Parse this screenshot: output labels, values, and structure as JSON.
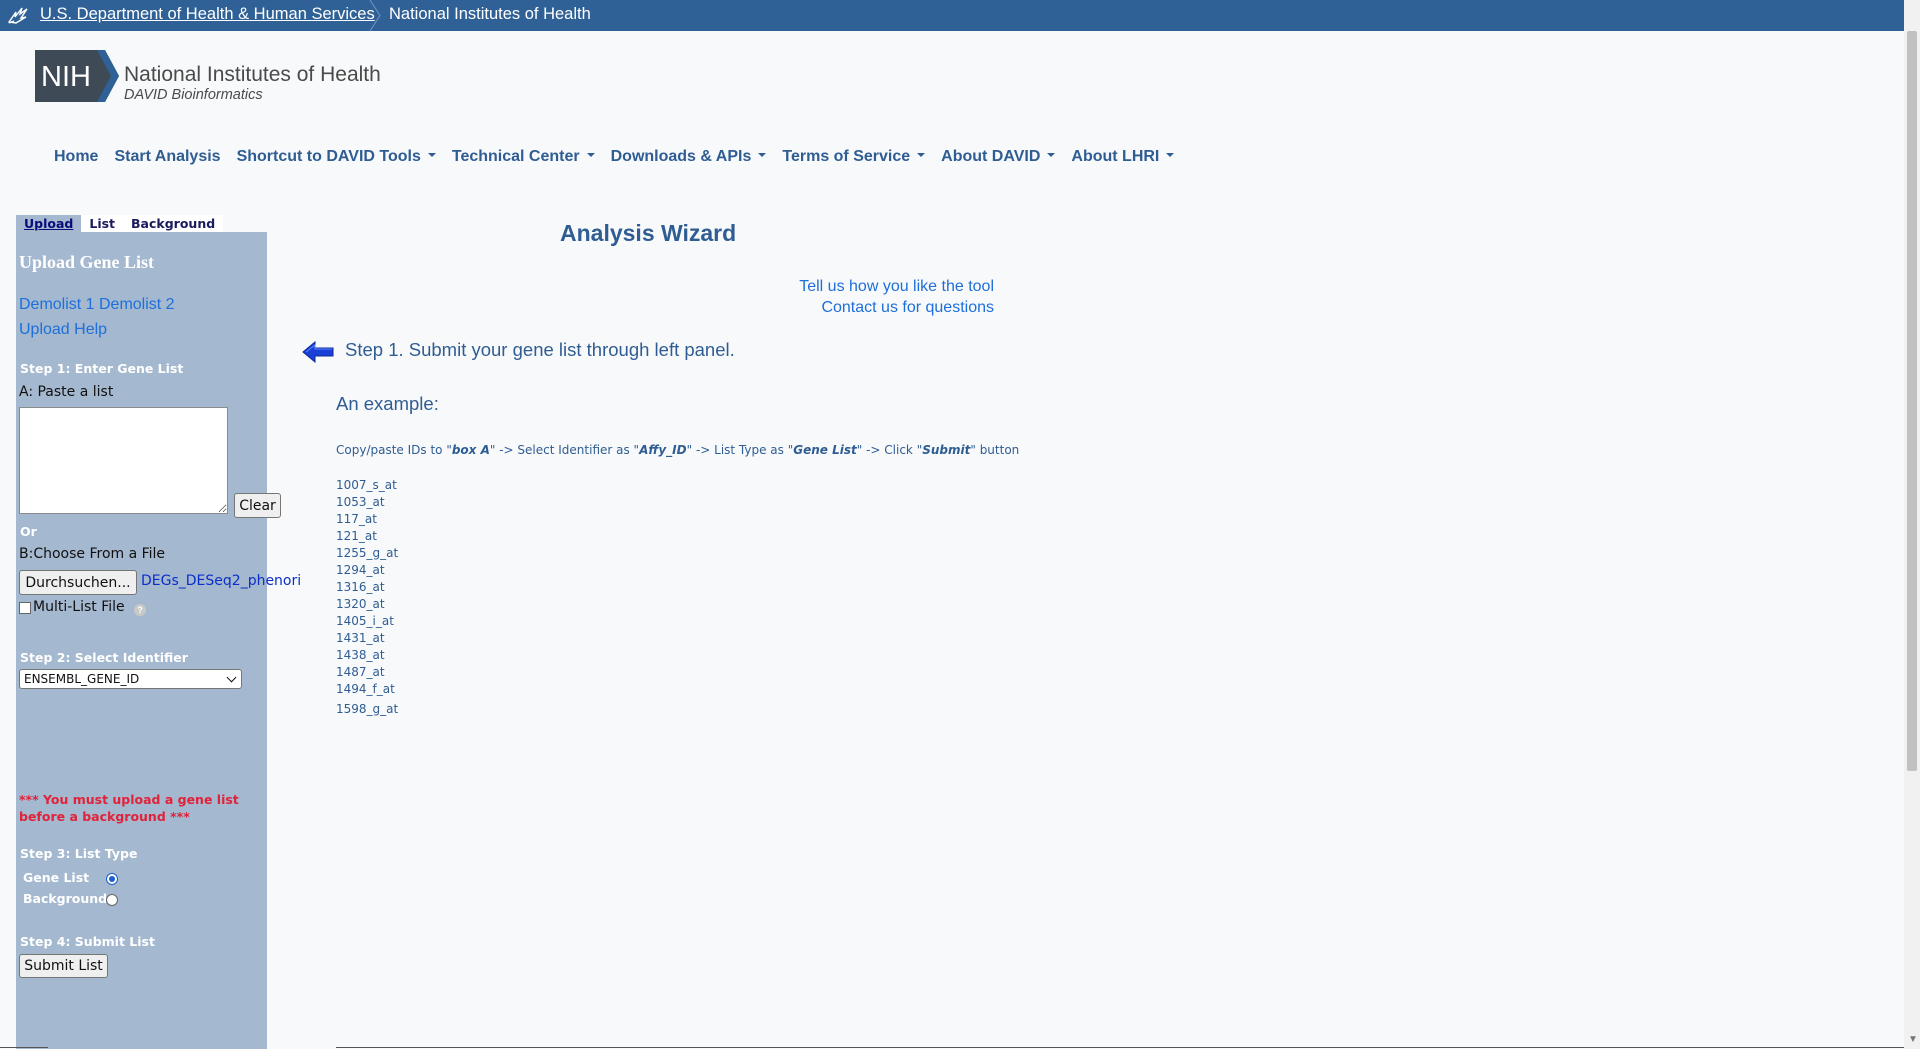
{
  "hhs_bar": {
    "hhs_link": "U.S. Department of Health & Human Services",
    "nih_link": "National Institutes of Health"
  },
  "logo": {
    "badge": "NIH",
    "title": "National Institutes of Health",
    "subtitle": "DAVID Bioinformatics"
  },
  "nav": {
    "items": [
      {
        "label": "Home",
        "dropdown": false
      },
      {
        "label": "Start Analysis",
        "dropdown": false
      },
      {
        "label": "Shortcut to DAVID Tools",
        "dropdown": true
      },
      {
        "label": "Technical Center",
        "dropdown": true
      },
      {
        "label": "Downloads & APIs",
        "dropdown": true
      },
      {
        "label": "Terms of Service",
        "dropdown": true
      },
      {
        "label": "About DAVID",
        "dropdown": true
      },
      {
        "label": "About LHRI",
        "dropdown": true
      }
    ]
  },
  "tabs": [
    "Upload",
    "List",
    "Background"
  ],
  "panel": {
    "title": "Upload Gene List",
    "demolist1": "Demolist 1",
    "demolist2": "Demolist 2",
    "upload_help": "Upload Help",
    "step1": "Step 1: Enter Gene List",
    "paste_label": "A: Paste a list",
    "paste_value": "",
    "clear_label": "Clear",
    "or_label": "Or",
    "file_label": "B:Choose From a File",
    "browse_label": "Durchsuchen...",
    "file_name": "DEGs_DESeq2_phenori",
    "multi_list_label": "Multi-List File",
    "help_glyph": "?",
    "step2": "Step 2: Select Identifier",
    "identifier": "ENSEMBL_GENE_ID",
    "warning": "*** You must upload a gene list before a background ***",
    "step3": "Step 3: List Type",
    "gene_list_label": "Gene List",
    "background_label": "Background",
    "list_type_selected": "Gene List",
    "step4": "Step 4: Submit List",
    "submit_label": "Submit List"
  },
  "main": {
    "title": "Analysis Wizard",
    "feedback_link": "Tell us how you like the tool",
    "contact_link": "Contact us for questions",
    "step1_text": "Step 1. Submit your gene list through left panel.",
    "example_title": "An example:",
    "instr": {
      "p1": "Copy/paste IDs to \"",
      "b1": "box A",
      "p2": "\" -> Select Identifier as  \"",
      "b2": "Affy_ID",
      "p3": "\" -> List Type as \"",
      "b3": "Gene List",
      "p4": "\" -> Click \"",
      "b4": "Submit",
      "p5": "\" button"
    },
    "example_ids": [
      "1007_s_at",
      "1053_at",
      "117_at",
      "121_at",
      "1255_g_at",
      "1294_at",
      "1316_at",
      "1320_at",
      "1405_i_at",
      "1431_at",
      "1438_at",
      "1487_at",
      "1494_f_at",
      "1598_g_at"
    ]
  },
  "colors": {
    "hhs_bar": "#2f6196",
    "panel": "#a4b8cf",
    "link": "#1e6fd9",
    "heading": "#2f5d93",
    "warning": "#e0223a"
  },
  "icons": {
    "hhs": "hhs-eagle-icon",
    "arrow": "left-arrow-icon"
  }
}
